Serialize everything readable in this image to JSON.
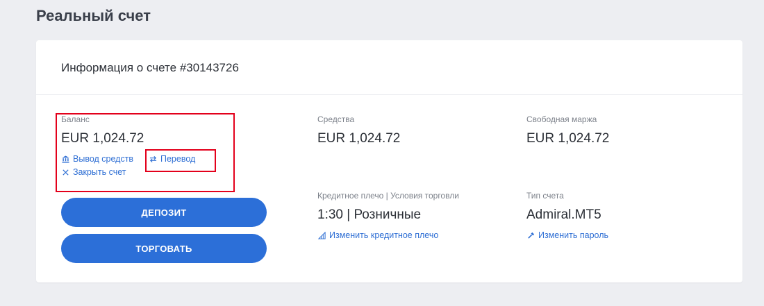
{
  "page": {
    "title": "Реальный счет"
  },
  "card": {
    "title": "Информация о счете #30143726",
    "balance": {
      "label": "Баланс",
      "value": "EUR 1,024.72",
      "withdraw_label": "Вывод средств",
      "transfer_label": "Перевод",
      "close_label": "Закрыть счет"
    },
    "funds": {
      "label": "Средства",
      "value": "EUR 1,024.72"
    },
    "free_margin": {
      "label": "Свободная маржа",
      "value": "EUR 1,024.72"
    },
    "leverage": {
      "label": "Кредитное плечо | Условия торговли",
      "value": "1:30 | Розничные",
      "change_label": "Изменить кредитное плечо"
    },
    "account_type": {
      "label": "Тип счета",
      "value": "Admiral.MT5",
      "change_password_label": "Изменить пароль"
    },
    "buttons": {
      "deposit": "ДЕПОЗИТ",
      "trade": "ТОРГОВАТЬ"
    }
  },
  "colors": {
    "accent": "#2c6fd8",
    "link": "#2f6fd4",
    "highlight": "#e3001b",
    "background": "#edeef2"
  },
  "icons": {
    "withdraw": "bank-icon",
    "transfer": "transfer-arrows-icon",
    "close": "close-icon",
    "leverage": "leverage-icon",
    "password": "key-icon"
  }
}
